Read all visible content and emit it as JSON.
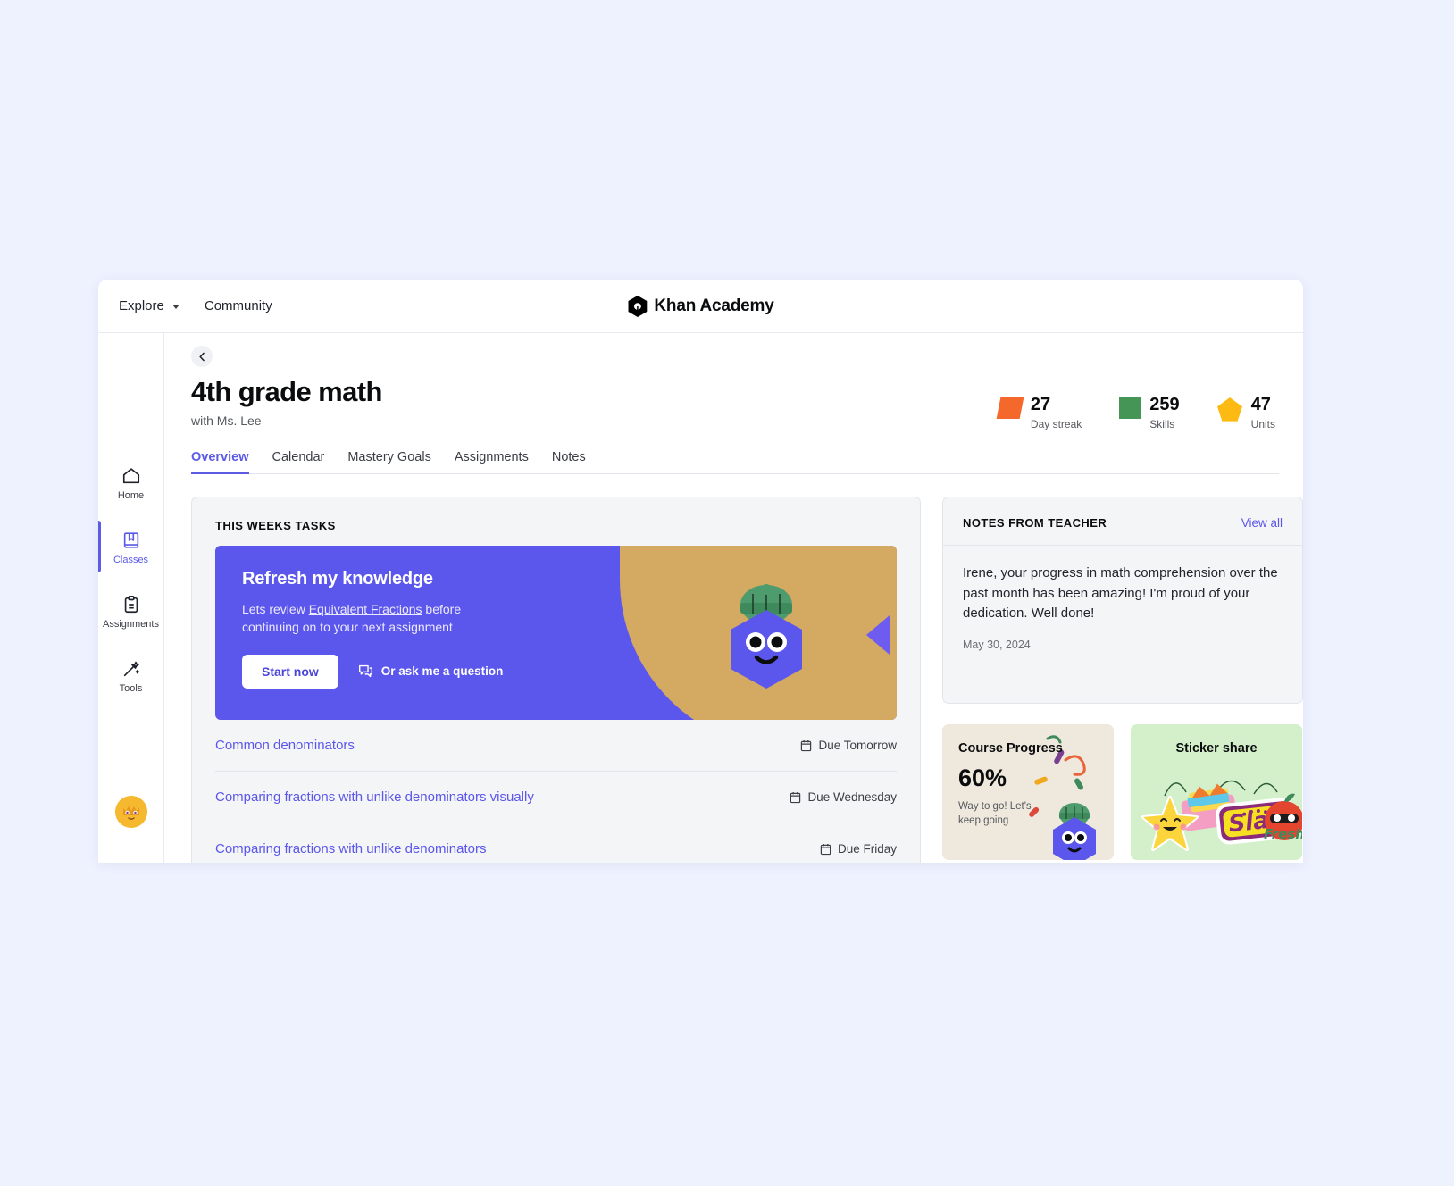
{
  "topnav": {
    "explore": "Explore",
    "community": "Community",
    "brand": "Khan Academy"
  },
  "sidebar": {
    "items": [
      {
        "label": "Home",
        "icon": "home-icon",
        "active": false
      },
      {
        "label": "Classes",
        "icon": "book-bookmark-icon",
        "active": true
      },
      {
        "label": "Assignments",
        "icon": "clipboard-icon",
        "active": false
      },
      {
        "label": "Tools",
        "icon": "magic-wand-icon",
        "active": false
      }
    ],
    "avatar_name": "user-avatar"
  },
  "header": {
    "back_label": "Back",
    "title": "4th grade math",
    "subtitle": "with Ms. Lee"
  },
  "stats": [
    {
      "value": "27",
      "label": "Day streak",
      "shape": "parallelogram",
      "color": "#f4682c"
    },
    {
      "value": "259",
      "label": "Skills",
      "shape": "square",
      "color": "#449556"
    },
    {
      "value": "47",
      "label": "Units",
      "shape": "pentagon",
      "color": "#fcba13"
    }
  ],
  "tabs": [
    {
      "label": "Overview",
      "active": true
    },
    {
      "label": "Calendar",
      "active": false
    },
    {
      "label": "Mastery Goals",
      "active": false
    },
    {
      "label": "Assignments",
      "active": false
    },
    {
      "label": "Notes",
      "active": false
    }
  ],
  "tasks": {
    "section_title": "THIS WEEKS TASKS",
    "banner": {
      "title": "Refresh my knowledge",
      "text_before": "Lets review ",
      "text_link": "Equivalent Fractions",
      "text_after": " before continuing on to your next assignment",
      "start_button": "Start now",
      "ask_link": "Or ask me a question"
    },
    "rows": [
      {
        "name": "Common denominators",
        "due": "Due Tomorrow"
      },
      {
        "name": "Comparing fractions with unlike denominators visually",
        "due": "Due Wednesday"
      },
      {
        "name": "Comparing fractions with unlike denominators",
        "due": "Due Friday"
      }
    ]
  },
  "notes": {
    "title": "NOTES FROM TEACHER",
    "view_all": "View all",
    "body": "Irene, your progress in math comprehension over the past month has been amazing! I'm proud of your dedication. Well done!",
    "date": "May 30, 2024"
  },
  "progress_card": {
    "title": "Course Progress",
    "percent": "60%",
    "note": "Way to go! Let's keep going"
  },
  "sticker_card": {
    "title": "Sticker share",
    "sticker_text": "Slay",
    "sticker_text_2": "Fresh"
  }
}
